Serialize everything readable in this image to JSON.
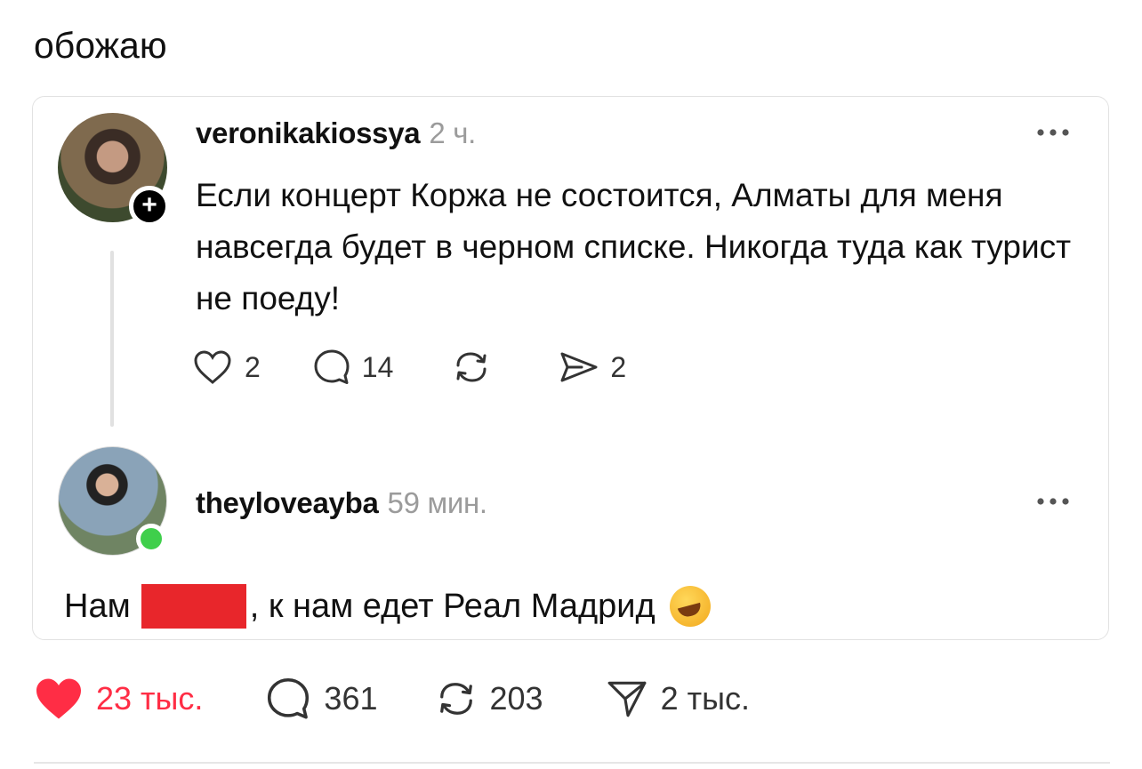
{
  "caption": "обожаю",
  "quoted_post": {
    "username": "veronikakiossya",
    "time": "2 ч.",
    "text": "Если концерт Коржа не состоится, Алматы для меня навсегда будет в черном списке. Никогда туда как турист не поеду!",
    "likes": "2",
    "replies": "14",
    "shares": "2"
  },
  "reply": {
    "username": "theyloveayba",
    "time": "59 мин.",
    "text_before": "Нам",
    "text_after": ", к нам едет Реал Мадрид"
  },
  "stats": {
    "likes": "23 тыс.",
    "comments": "361",
    "reposts": "203",
    "shares": "2 тыс."
  },
  "colors": {
    "like_active": "#ff2d45",
    "redaction": "#e8262b",
    "online": "#3fcf4b",
    "muted_text": "#9b9b9b"
  }
}
